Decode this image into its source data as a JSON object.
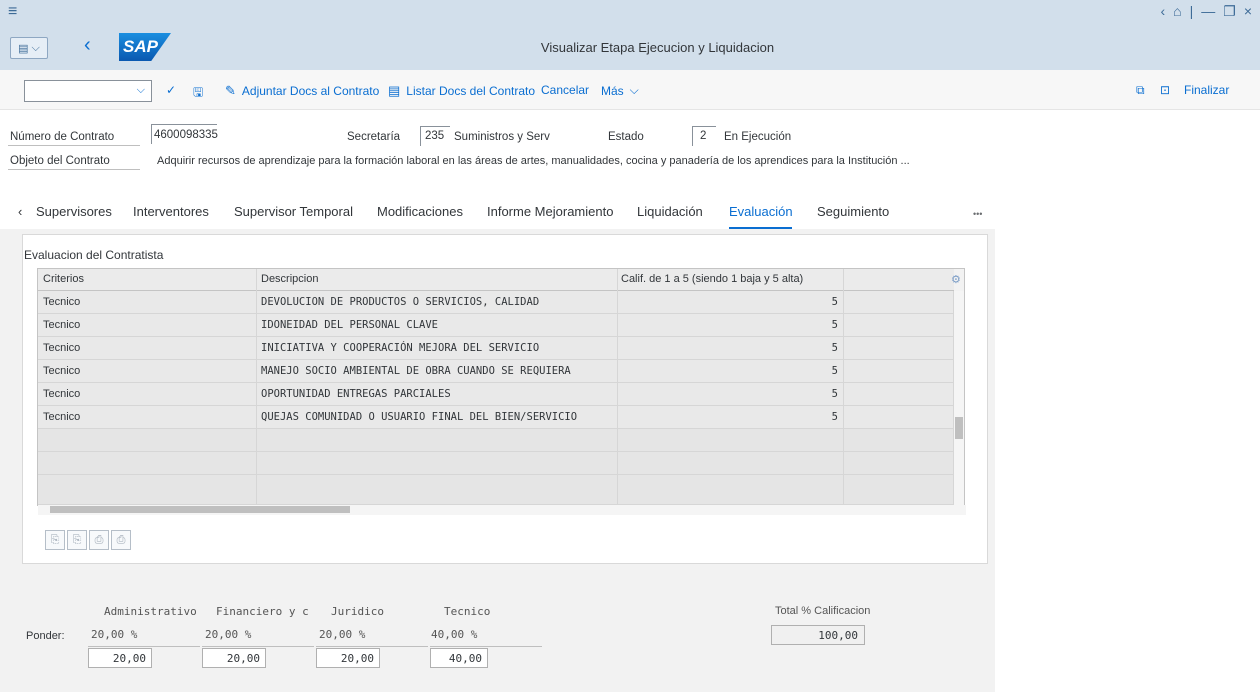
{
  "window": {
    "menu_icon": "hamburger-icon",
    "controls": [
      "‹",
      "⎙",
      "|",
      "—",
      "❐",
      "×"
    ]
  },
  "shell": {
    "title": "Visualizar Etapa Ejecucion y Liquidacion",
    "logo": "SAP"
  },
  "toolbar": {
    "combo_value": "",
    "items": [
      {
        "label": "Adjuntar Docs al Contrato"
      },
      {
        "label": "Listar Docs del Contrato"
      },
      {
        "label": "Cancelar"
      },
      {
        "label": "Más"
      }
    ],
    "finalizar": "Finalizar"
  },
  "header": {
    "contrato_label": "Número de Contrato",
    "contrato_value": "4600098335",
    "secretaria_label": "Secretaría",
    "secretaria_code": "235",
    "secretaria_text": "Suministros y Serv",
    "estado_label": "Estado",
    "estado_code": "2",
    "estado_text": "En Ejecución",
    "objeto_label": "Objeto del Contrato",
    "objeto_value": "Adquirir recursos de aprendizaje para la formación laboral en las áreas de artes, manualidades, cocina y panadería de los aprendices para la Institución ..."
  },
  "tabs": [
    {
      "label": "Supervisores"
    },
    {
      "label": "Interventores"
    },
    {
      "label": "Supervisor Temporal"
    },
    {
      "label": "Modificaciones"
    },
    {
      "label": "Informe Mejoramiento"
    },
    {
      "label": "Liquidación"
    },
    {
      "label": "Evaluación",
      "active": true
    },
    {
      "label": "Seguimiento"
    }
  ],
  "tabs_more": "•••",
  "evaluation": {
    "title": "Evaluacion del Contratista",
    "columns": [
      "Criterios",
      "Descripcion",
      "Calif. de 1 a 5 (siendo 1 baja y 5 alta)"
    ],
    "rows": [
      {
        "criterio": "Tecnico",
        "descripcion": "DEVOLUCION DE PRODUCTOS O SERVICIOS, CALIDAD",
        "calif": "5"
      },
      {
        "criterio": "Tecnico",
        "descripcion": "IDONEIDAD DEL PERSONAL CLAVE",
        "calif": "5"
      },
      {
        "criterio": "Tecnico",
        "descripcion": "INICIATIVA Y COOPERACIÓN MEJORA DEL SERVICIO",
        "calif": "5"
      },
      {
        "criterio": "Tecnico",
        "descripcion": "MANEJO SOCIO AMBIENTAL DE OBRA CUANDO SE REQUIERA",
        "calif": "5"
      },
      {
        "criterio": "Tecnico",
        "descripcion": "OPORTUNIDAD ENTREGAS PARCIALES",
        "calif": "5"
      },
      {
        "criterio": "Tecnico",
        "descripcion": "QUEJAS COMUNIDAD O USUARIO FINAL DEL BIEN/SERVICIO",
        "calif": "5"
      }
    ]
  },
  "ponder": {
    "label": "Ponder:",
    "columns": [
      {
        "header": "Administrativo",
        "pct": "20,00  %",
        "value": "20,00"
      },
      {
        "header": "Financiero y c",
        "pct": "20,00  %",
        "value": "20,00"
      },
      {
        "header": "Juridico",
        "pct": "20,00  %",
        "value": "20,00"
      },
      {
        "header": "Tecnico",
        "pct": "40,00  %",
        "value": "40,00"
      }
    ],
    "total_label": "Total % Calificacion",
    "total_value": "100,00"
  }
}
